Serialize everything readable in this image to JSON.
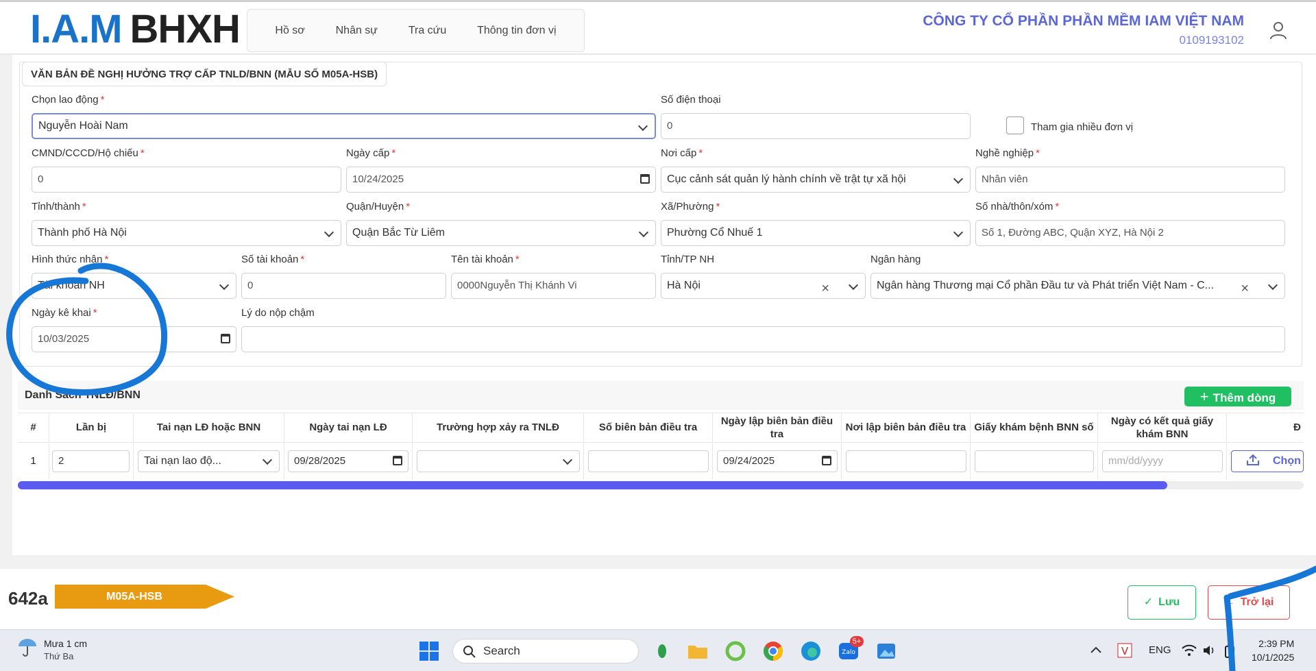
{
  "header": {
    "logo_iam": "I.A.M",
    "logo_bhxh": "BHXH",
    "nav": [
      "Hồ sơ",
      "Nhân sự",
      "Tra cứu",
      "Thông tin đơn vị"
    ],
    "company_name": "CÔNG TY CỔ PHẦN PHẦN MỀM IAM VIỆT NAM",
    "company_tax": "0109193102"
  },
  "form": {
    "title": "VĂN BẢN ĐỀ NGHỊ HƯỞNG TRỢ CẤP TNLD/BNN (MẪU SỐ M05A-HSB)",
    "employee": {
      "label": "Chọn lao động",
      "value": "Nguyễn Hoài Nam"
    },
    "phone": {
      "label": "Số điện thoại",
      "value": "0"
    },
    "multi_unit": {
      "label": "Tham gia nhiều đơn vị"
    },
    "id_number": {
      "label": "CMND/CCCD/Hộ chiếu",
      "value": "0"
    },
    "issue_date": {
      "label": "Ngày cấp",
      "value": "10/24/2025"
    },
    "issue_place": {
      "label": "Nơi cấp",
      "value": "Cục cảnh sát quản lý hành chính về trật tự xã hội"
    },
    "occupation": {
      "label": "Nghề nghiệp",
      "value": "Nhân viên"
    },
    "province": {
      "label": "Tỉnh/thành",
      "value": "Thành phố Hà Nội"
    },
    "district": {
      "label": "Quận/Huyện",
      "value": "Quận Bắc Từ Liêm"
    },
    "ward": {
      "label": "Xã/Phường",
      "value": "Phường Cổ Nhuế 1"
    },
    "address": {
      "label": "Số nhà/thôn/xóm",
      "value": "Số 1, Đường ABC, Quận XYZ, Hà Nội 2"
    },
    "receive_method": {
      "label": "Hình thức nhận",
      "value": "Tài khoản NH"
    },
    "account_no": {
      "label": "Số tài khoản",
      "value": "0"
    },
    "account_name": {
      "label": "Tên tài khoản",
      "value": "0000Nguyễn Thị Khánh Vi"
    },
    "bank_province": {
      "label": "Tỉnh/TP NH",
      "value": "Hà Nội"
    },
    "bank": {
      "label": "Ngân hàng",
      "value": "Ngân hàng Thương mại Cổ phần Đầu tư và Phát triển Việt Nam - C..."
    },
    "declare_date": {
      "label": "Ngày kê khai",
      "value": "10/03/2025"
    },
    "late_reason": {
      "label": "Lý do nộp chậm",
      "value": ""
    }
  },
  "table": {
    "title": "Danh Sách TNLĐ/BNN",
    "add_label": "Thêm dòng",
    "columns": [
      "#",
      "Lần bị",
      "Tai nạn LĐ hoặc BNN",
      "Ngày tai nạn LĐ",
      "Trường hợp xảy ra TNLĐ",
      "Số biên bản điều tra",
      "Ngày lập biên bản điều tra",
      "Nơi lập biên bản điều tra",
      "Giấy khám bệnh BNN số",
      "Ngày có kết quả giấy khám BNN",
      "Đ"
    ],
    "rows": [
      {
        "index": "1",
        "times": "2",
        "type": "Tai nạn lao độ...",
        "accident_date": "09/28/2025",
        "case": "",
        "report_no": "",
        "report_date": "09/24/2025",
        "report_place": "",
        "exam_no": "",
        "exam_date_placeholder": "mm/dd/yyyy",
        "upload_label": "Chọn"
      }
    ]
  },
  "footer": {
    "code": "642a",
    "form_code": "M05A-HSB",
    "save_label": "Lưu",
    "back_label": "Trở lại"
  },
  "taskbar": {
    "weather_line1": "Mưa 1 cm",
    "weather_line2": "Thứ Ba",
    "search_placeholder": "Search",
    "lang": "ENG",
    "time": "2:39 PM",
    "date": "10/1/2025",
    "badge": "5+"
  },
  "colors": {
    "brand_blue": "#1a73c9",
    "accent": "#5b67d6",
    "green": "#1fbf62",
    "red": "#e34b4b",
    "tag_orange": "#e89a10",
    "annotation_blue": "#1677d6"
  }
}
